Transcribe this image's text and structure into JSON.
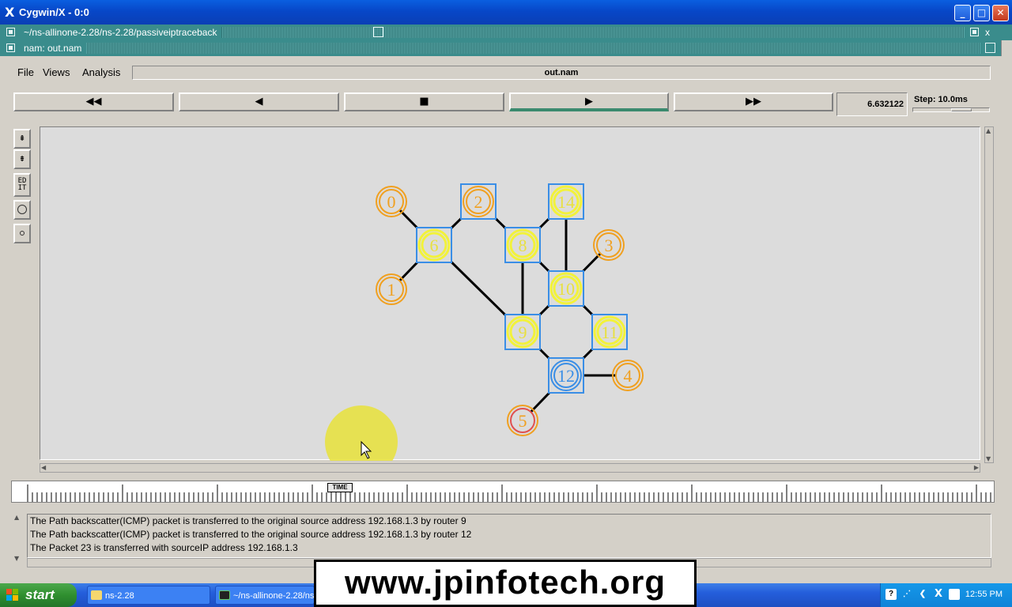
{
  "window": {
    "title": "Cygwin/X - 0:0"
  },
  "bar1": {
    "title": "~/ns-allinone-2.28/ns-2.28/passiveiptraceback",
    "right_label": "x"
  },
  "bar2": {
    "title": "nam: out.nam"
  },
  "menu": {
    "file": "File",
    "views": "Views",
    "analysis": "Analysis"
  },
  "filename": "out.nam",
  "controls": {
    "rewind_icon": "fast-rewind-icon",
    "back_icon": "play-backward-icon",
    "stop_icon": "stop-icon",
    "play_icon": "play-icon",
    "ff_icon": "fast-forward-icon",
    "active": "play"
  },
  "time": "6.632122",
  "step": {
    "label": "Step: 10.0ms"
  },
  "tools": {
    "edit": "ED IT"
  },
  "timeline": {
    "label": "TIME"
  },
  "log": [
    "The Path backscatter(ICMP) packet is transferred to the original source address 192.168.1.3 by router 9",
    "The Path backscatter(ICMP) packet is transferred to the original source address 192.168.1.3 by router 12",
    "The Packet 23 is transferred with sourceIP address 192.168.1.3"
  ],
  "topology": {
    "nodes": [
      {
        "label": "0",
        "kind": "host"
      },
      {
        "label": "1",
        "kind": "host"
      },
      {
        "label": "2",
        "kind": "host-boxed"
      },
      {
        "label": "3",
        "kind": "host"
      },
      {
        "label": "4",
        "kind": "host"
      },
      {
        "label": "5",
        "kind": "source"
      },
      {
        "label": "6",
        "kind": "router"
      },
      {
        "label": "8",
        "kind": "router"
      },
      {
        "label": "9",
        "kind": "router"
      },
      {
        "label": "10",
        "kind": "router"
      },
      {
        "label": "11",
        "kind": "router"
      },
      {
        "label": "12",
        "kind": "router-active"
      },
      {
        "label": "14",
        "kind": "router"
      }
    ],
    "links": [
      [
        "0",
        "6"
      ],
      [
        "1",
        "6"
      ],
      [
        "6",
        "2"
      ],
      [
        "6",
        "9"
      ],
      [
        "2",
        "8"
      ],
      [
        "8",
        "14"
      ],
      [
        "8",
        "9"
      ],
      [
        "8",
        "10"
      ],
      [
        "14",
        "10"
      ],
      [
        "3",
        "10"
      ],
      [
        "10",
        "9"
      ],
      [
        "10",
        "11"
      ],
      [
        "9",
        "12"
      ],
      [
        "11",
        "12"
      ],
      [
        "12",
        "4"
      ],
      [
        "12",
        "5"
      ]
    ]
  },
  "taskbar": {
    "start": "start",
    "tasks": [
      "ns-2.28",
      "~/ns-allinone-2.28/ns"
    ],
    "clock": "12:55 PM"
  },
  "watermark": "www.jpinfotech.org",
  "colors": {
    "host": "#f0a020",
    "router_box": "#3a8ee6",
    "router_fill": "#f2f23a",
    "source": "#e05050",
    "teal": "#3a8c8c"
  }
}
